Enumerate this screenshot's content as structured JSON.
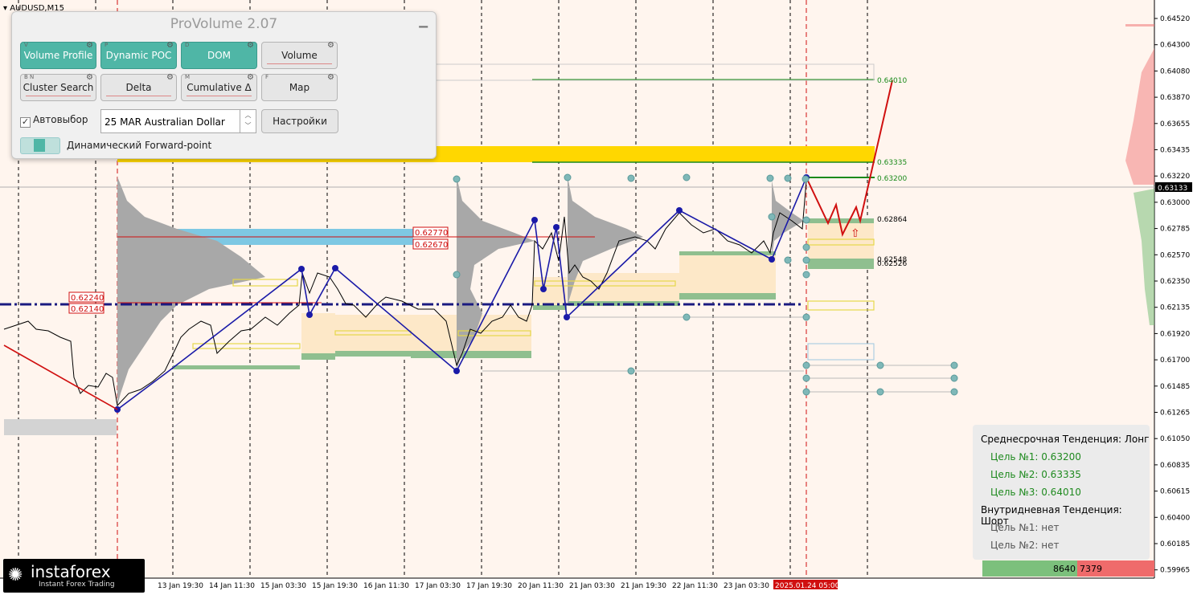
{
  "chart": {
    "symbol": "AUDUSD,M15",
    "price_axis": [
      "0.64520",
      "0.64300",
      "0.64080",
      "0.63870",
      "0.63655",
      "0.63435",
      "0.63220",
      "0.63000",
      "0.62785",
      "0.62570",
      "0.62350",
      "0.62135",
      "0.61920",
      "0.61700",
      "0.61485",
      "0.61265",
      "0.61050",
      "0.60835",
      "0.60615",
      "0.60400",
      "0.60185",
      "0.59965"
    ],
    "current_price": "0.63133",
    "time_axis": [
      "13 Jan 19:30",
      "14 Jan 11:30",
      "15 Jan 03:30",
      "15 Jan 19:30",
      "16 Jan 11:30",
      "17 Jan 03:30",
      "17 Jan 19:30",
      "20 Jan 11:30",
      "21 Jan 03:30",
      "21 Jan 19:30",
      "22 Jan 11:30",
      "23 Jan 03:30",
      "2025.01.24 05:00"
    ],
    "level_labels": {
      "l64010": "0.64010",
      "l63335": "0.63335",
      "l63200": "0.63200",
      "l62864": "0.62864",
      "l62548": "0.62548",
      "l62526": "0.62526"
    },
    "red_labels": {
      "a": "0.62770",
      "b": "0.62670",
      "c": "0.62240",
      "d": "0.62140"
    },
    "colors": {
      "bg": "#fff5ee",
      "price_line": "#000000",
      "zigzag": "#1a1aa8",
      "forecast": "#d01010",
      "yellow_zone": "#ffd700",
      "blue_zone": "#7ec8e3",
      "poc_line": "#1a1a80",
      "sell_vol": "#ef6b6b",
      "buy_vol": "#7cc07c"
    }
  },
  "panel": {
    "title": "ProVolume 2.07",
    "buttons": [
      {
        "label": "Volume Profile",
        "key": "V",
        "active": true
      },
      {
        "label": "Dynamic POC",
        "key": "P",
        "active": true
      },
      {
        "label": "DOM",
        "key": "D",
        "active": true
      },
      {
        "label": "Volume",
        "key": "",
        "active": false
      },
      {
        "label": "Cluster Search",
        "key": "B N",
        "active": false
      },
      {
        "label": "Delta",
        "key": "",
        "active": false
      },
      {
        "label": "Cumulative Δ",
        "key": "M",
        "active": false
      },
      {
        "label": "Map",
        "key": "F",
        "active": false
      }
    ],
    "autoselect_label": "Автовыбор",
    "autoselect_checked": true,
    "instrument": "25 MAR Australian Dollar",
    "settings_button": "Настройки",
    "forward_point_label": "Динамический Forward-point"
  },
  "info": {
    "mid_trend": "Среднесрочная Тенденция: Лонг",
    "target1": "Цель №1: 0.63200",
    "target2": "Цель №2: 0.63335",
    "target3": "Цель №3: 0.64010",
    "intraday_trend": "Внутридневная Тенденция: Шорт",
    "intraday_target1": "Цель №1: нет",
    "intraday_target2": "Цель №2: нет"
  },
  "volume_bar": {
    "buy": "8640",
    "sell": "7379"
  },
  "logo": {
    "name": "instaforex",
    "tagline": "Instant Forex Trading"
  }
}
